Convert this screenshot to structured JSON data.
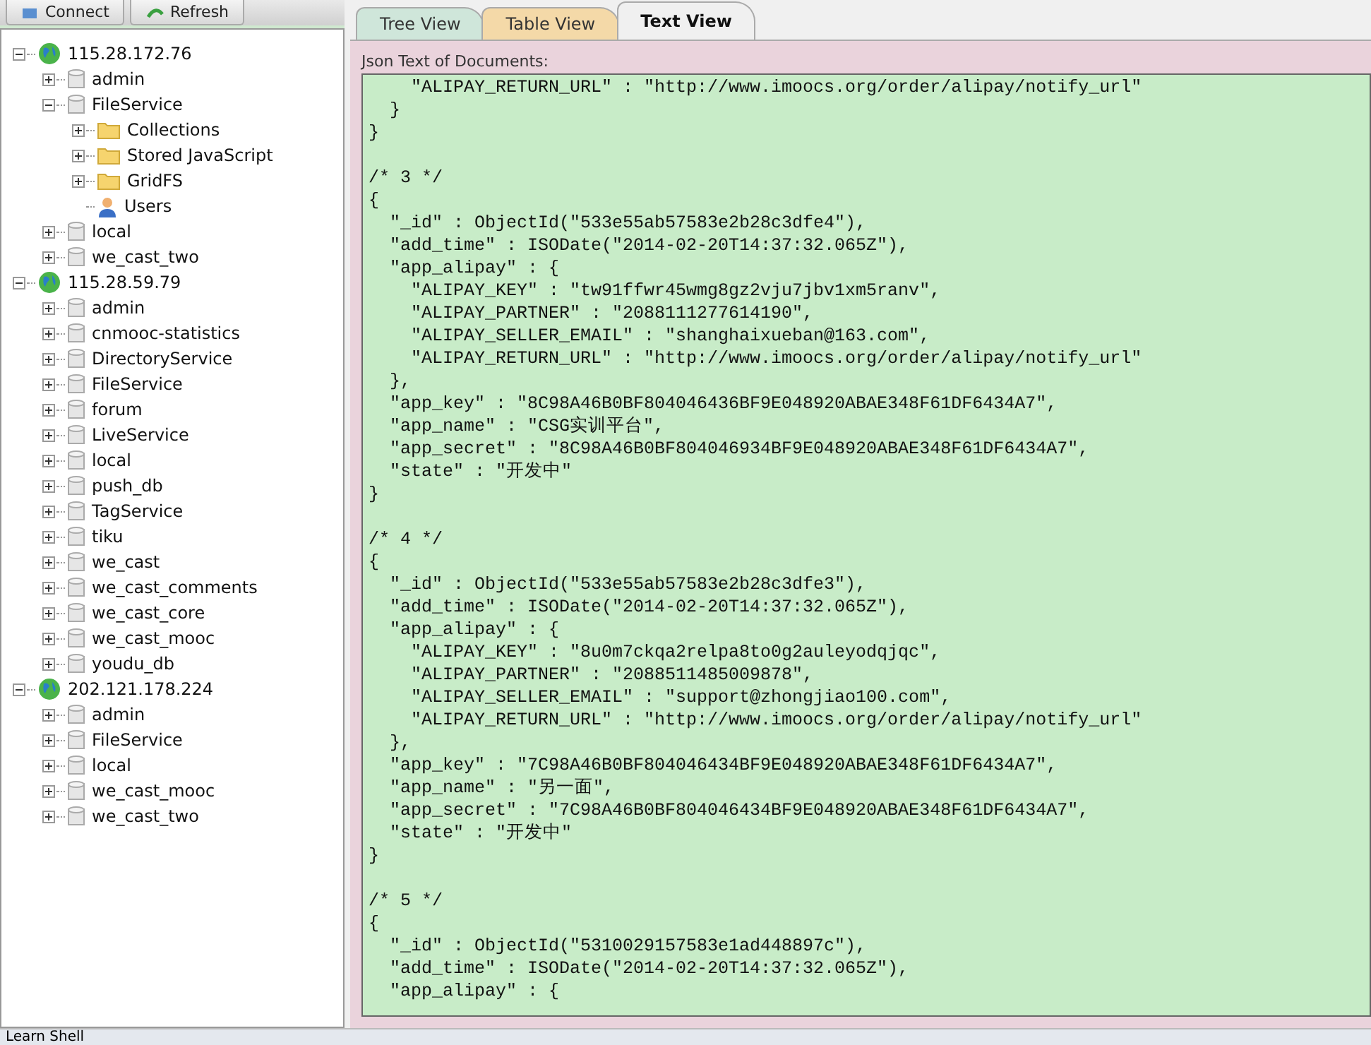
{
  "toolbar": {
    "buttons": [
      {
        "label": "Connect",
        "kind": "connect"
      },
      {
        "label": "Refresh",
        "kind": "refresh"
      }
    ]
  },
  "tree": [
    {
      "label": "115.28.172.76",
      "kind": "server",
      "expanded": true,
      "children": [
        {
          "label": "admin",
          "kind": "database",
          "expanded": false
        },
        {
          "label": "FileService",
          "kind": "database",
          "expanded": true,
          "children": [
            {
              "label": "Collections",
              "kind": "folder",
              "expanded": false
            },
            {
              "label": "Stored JavaScript",
              "kind": "folder",
              "expanded": false
            },
            {
              "label": "GridFS",
              "kind": "folder",
              "expanded": false
            },
            {
              "label": "Users",
              "kind": "user"
            }
          ]
        },
        {
          "label": "local",
          "kind": "database",
          "expanded": false
        },
        {
          "label": "we_cast_two",
          "kind": "database",
          "expanded": false
        }
      ]
    },
    {
      "label": "115.28.59.79",
      "kind": "server",
      "expanded": true,
      "children": [
        {
          "label": "admin",
          "kind": "database",
          "expanded": false
        },
        {
          "label": "cnmooc-statistics",
          "kind": "database",
          "expanded": false
        },
        {
          "label": "DirectoryService",
          "kind": "database",
          "expanded": false
        },
        {
          "label": "FileService",
          "kind": "database",
          "expanded": false
        },
        {
          "label": "forum",
          "kind": "database",
          "expanded": false
        },
        {
          "label": "LiveService",
          "kind": "database",
          "expanded": false
        },
        {
          "label": "local",
          "kind": "database",
          "expanded": false
        },
        {
          "label": "push_db",
          "kind": "database",
          "expanded": false
        },
        {
          "label": "TagService",
          "kind": "database",
          "expanded": false
        },
        {
          "label": "tiku",
          "kind": "database",
          "expanded": false
        },
        {
          "label": "we_cast",
          "kind": "database",
          "expanded": false
        },
        {
          "label": "we_cast_comments",
          "kind": "database",
          "expanded": false
        },
        {
          "label": "we_cast_core",
          "kind": "database",
          "expanded": false
        },
        {
          "label": "we_cast_mooc",
          "kind": "database",
          "expanded": false
        },
        {
          "label": "youdu_db",
          "kind": "database",
          "expanded": false
        }
      ]
    },
    {
      "label": "202.121.178.224",
      "kind": "server",
      "expanded": true,
      "children": [
        {
          "label": "admin",
          "kind": "database",
          "expanded": false
        },
        {
          "label": "FileService",
          "kind": "database",
          "expanded": false
        },
        {
          "label": "local",
          "kind": "database",
          "expanded": false
        },
        {
          "label": "we_cast_mooc",
          "kind": "database",
          "expanded": false
        },
        {
          "label": "we_cast_two",
          "kind": "database",
          "expanded": false
        }
      ]
    }
  ],
  "tabs": [
    {
      "label": "Tree View",
      "selected": false,
      "color": "#cfe6da"
    },
    {
      "label": "Table View",
      "selected": false,
      "color": "#f4d9a8"
    },
    {
      "label": "Text View",
      "selected": true,
      "color": "#f0f0f0"
    }
  ],
  "text_panel": {
    "label": "Json Text of Documents:",
    "blocks": [
      [
        "    \"ALIPAY_RETURN_URL\" : \"http://www.imoocs.org/order/alipay/notify_url\"",
        "  }",
        "}"
      ],
      [
        "/* 3 */",
        "{",
        "  \"_id\" : ObjectId(\"533e55ab57583e2b28c3dfe4\"),",
        "  \"add_time\" : ISODate(\"2014-02-20T14:37:32.065Z\"),",
        "  \"app_alipay\" : {",
        "    \"ALIPAY_KEY\" : \"tw91ffwr45wmg8gz2vju7jbv1xm5ranv\",",
        "    \"ALIPAY_PARTNER\" : \"2088111277614190\",",
        "    \"ALIPAY_SELLER_EMAIL\" : \"shanghaixueban@163.com\",",
        "    \"ALIPAY_RETURN_URL\" : \"http://www.imoocs.org/order/alipay/notify_url\"",
        "  },",
        "  \"app_key\" : \"8C98A46B0BF804046436BF9E048920ABAE348F61DF6434A7\",",
        "  \"app_name\" : \"CSG实训平台\",",
        "  \"app_secret\" : \"8C98A46B0BF804046934BF9E048920ABAE348F61DF6434A7\",",
        "  \"state\" : \"开发中\"",
        "}"
      ],
      [
        "/* 4 */",
        "{",
        "  \"_id\" : ObjectId(\"533e55ab57583e2b28c3dfe3\"),",
        "  \"add_time\" : ISODate(\"2014-02-20T14:37:32.065Z\"),",
        "  \"app_alipay\" : {",
        "    \"ALIPAY_KEY\" : \"8u0m7ckqa2relpa8to0g2auleyodqjqc\",",
        "    \"ALIPAY_PARTNER\" : \"2088511485009878\",",
        "    \"ALIPAY_SELLER_EMAIL\" : \"support@zhongjiao100.com\",",
        "    \"ALIPAY_RETURN_URL\" : \"http://www.imoocs.org/order/alipay/notify_url\"",
        "  },",
        "  \"app_key\" : \"7C98A46B0BF804046434BF9E048920ABAE348F61DF6434A7\",",
        "  \"app_name\" : \"另一面\",",
        "  \"app_secret\" : \"7C98A46B0BF804046434BF9E048920ABAE348F61DF6434A7\",",
        "  \"state\" : \"开发中\"",
        "}"
      ],
      [
        "/* 5 */",
        "{",
        "  \"_id\" : ObjectId(\"5310029157583e1ad448897c\"),",
        "  \"add_time\" : ISODate(\"2014-02-20T14:37:32.065Z\"),",
        "  \"app_alipay\" : {"
      ]
    ]
  },
  "status_bar": {
    "text": "Learn Shell"
  }
}
